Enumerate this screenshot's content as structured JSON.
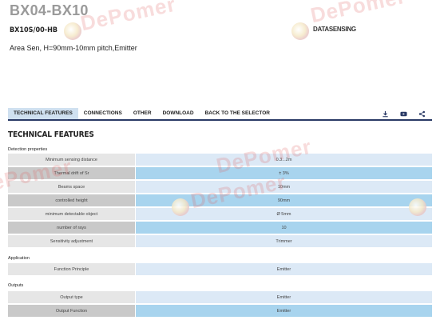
{
  "product": {
    "title": "BX04-BX10",
    "code": "BX10S/00-HB",
    "brand": "DATASENSING",
    "description": "Area Sen, H=90mm-10mm pitch,Emitter"
  },
  "nav": {
    "tabs": [
      "TECHNICAL FEATURES",
      "CONNECTIONS",
      "OTHER",
      "DOWNLOAD",
      "BACK TO THE SELECTOR"
    ],
    "icons": [
      "download-icon",
      "youtube-icon",
      "share-icon"
    ],
    "accent": "#2a3a66"
  },
  "section": {
    "title": "TECHNICAL FEATURES"
  },
  "groups": [
    {
      "label": "Detection properties",
      "rows": [
        {
          "key": "Minimum sensing distance",
          "value": "0.3...2m"
        },
        {
          "key": "Thermal drift of Sr",
          "value": "± 3%"
        },
        {
          "key": "Beams space",
          "value": "10mm"
        },
        {
          "key": "controlled height",
          "value": "90mm"
        },
        {
          "key": "minimum detectable object",
          "value": "Ø 5mm"
        },
        {
          "key": "number of rays",
          "value": "10"
        },
        {
          "key": "Sensitivity adjustment",
          "value": "Trimmer"
        }
      ]
    },
    {
      "label": "Application",
      "rows": [
        {
          "key": "Function Principle",
          "value": "Emitter"
        }
      ]
    },
    {
      "label": "Outputs",
      "rows": [
        {
          "key": "Output type",
          "value": "Emitter"
        },
        {
          "key": "Output Function",
          "value": "Emitter"
        }
      ]
    }
  ],
  "watermark": {
    "text": "DePomer",
    "color": "#e15f5f"
  }
}
